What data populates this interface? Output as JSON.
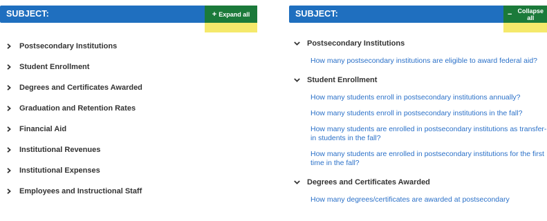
{
  "left_panel": {
    "header_title": "SUBJECT:",
    "toggle_label": "Expand all",
    "toggle_symbol": "+",
    "items": [
      {
        "label": "Postsecondary Institutions"
      },
      {
        "label": "Student Enrollment"
      },
      {
        "label": "Degrees and Certificates Awarded"
      },
      {
        "label": "Graduation and Retention Rates"
      },
      {
        "label": "Financial Aid"
      },
      {
        "label": "Institutional Revenues"
      },
      {
        "label": "Institutional Expenses"
      },
      {
        "label": "Employees and Instructional Staff"
      }
    ]
  },
  "right_panel": {
    "header_title": "SUBJECT:",
    "toggle_label": "Collapse all",
    "toggle_symbol": "−",
    "sections": [
      {
        "heading": "Postsecondary Institutions",
        "questions": [
          "How many postsecondary institutions are eligible to award federal aid?"
        ]
      },
      {
        "heading": "Student Enrollment",
        "questions": [
          "How many students enroll in postsecondary institutions annually?",
          "How many students enroll in postsecondary institutions in the fall?",
          "How many students are enrolled in postsecondary institutions as transfer-in students in the fall?",
          "How many students are enrolled in postsecondary institutions for the first time in the fall?"
        ]
      },
      {
        "heading": "Degrees and Certificates Awarded",
        "questions": [
          "How many degrees/certificates are awarded at postsecondary"
        ]
      }
    ]
  },
  "colors": {
    "header_blue": "#1f6fbf",
    "button_green": "#1b7a3a",
    "highlight_yellow": "#f5e96b",
    "link_blue": "#2a70c8"
  }
}
